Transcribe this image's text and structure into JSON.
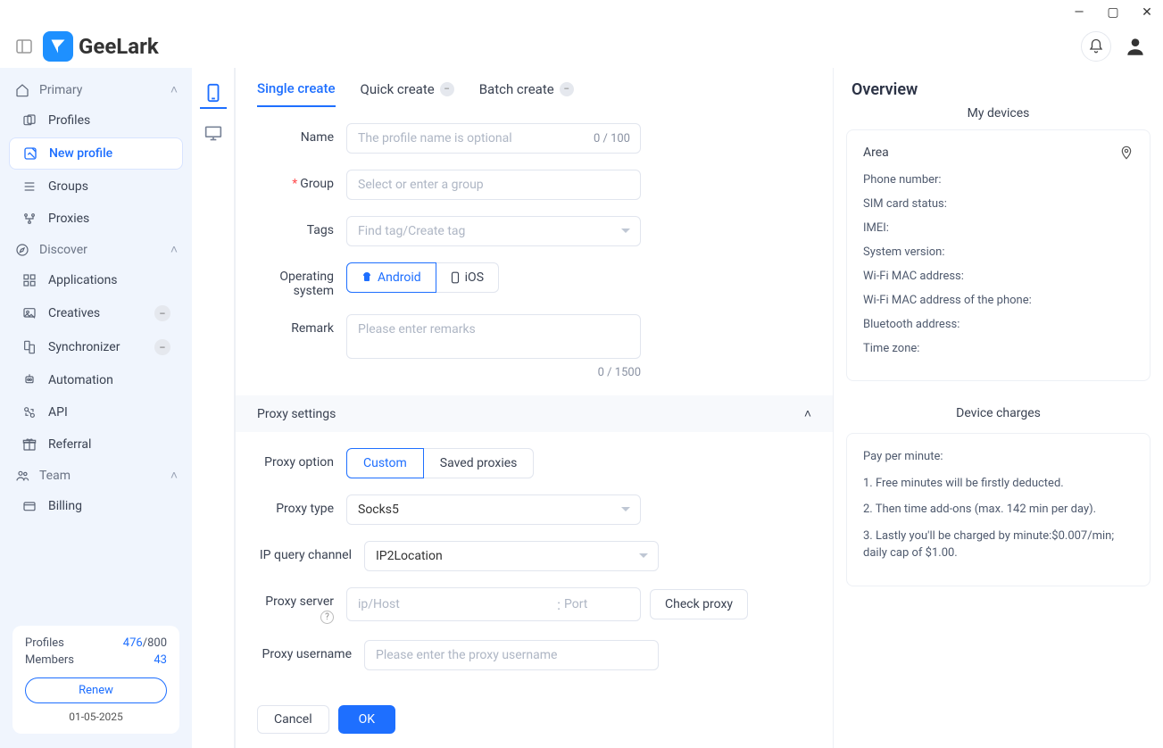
{
  "app": {
    "name": "GeeLark"
  },
  "topbar": {},
  "sidebar": {
    "sections": {
      "primary": {
        "label": "Primary"
      },
      "discover": {
        "label": "Discover"
      },
      "team": {
        "label": "Team"
      }
    },
    "items": {
      "profiles": "Profiles",
      "newProfile": "New profile",
      "groups": "Groups",
      "proxies": "Proxies",
      "applications": "Applications",
      "creatives": "Creatives",
      "synchronizer": "Synchronizer",
      "automation": "Automation",
      "api": "API",
      "referral": "Referral",
      "billing": "Billing"
    },
    "footer": {
      "profilesLabel": "Profiles",
      "profilesUsed": "476",
      "profilesSep": "/",
      "profilesTotal": "800",
      "membersLabel": "Members",
      "membersCount": "43",
      "renew": "Renew",
      "date": "01-05-2025"
    }
  },
  "tabs": {
    "single": "Single create",
    "quick": "Quick create",
    "batch": "Batch create"
  },
  "form": {
    "name": {
      "label": "Name",
      "placeholder": "The profile name is optional",
      "counter": "0 / 100"
    },
    "group": {
      "label": "Group",
      "placeholder": "Select or enter a group"
    },
    "tags": {
      "label": "Tags",
      "placeholder": "Find tag/Create tag"
    },
    "os": {
      "label": "Operating system",
      "android": "Android",
      "ios": "iOS"
    },
    "remark": {
      "label": "Remark",
      "placeholder": "Please enter remarks",
      "counter": "0 / 1500"
    },
    "proxy": {
      "section": "Proxy settings",
      "optionLabel": "Proxy option",
      "custom": "Custom",
      "saved": "Saved proxies",
      "typeLabel": "Proxy type",
      "typeValue": "Socks5",
      "ipChannelLabel": "IP query channel",
      "ipChannelValue": "IP2Location",
      "serverLabel": "Proxy server",
      "serverHost": "ip/Host",
      "serverSep": ":",
      "serverPort": "Port",
      "checkProxy": "Check proxy",
      "usernameLabel": "Proxy username",
      "usernamePlaceholder": "Please enter the proxy username"
    },
    "actions": {
      "cancel": "Cancel",
      "ok": "OK"
    }
  },
  "overview": {
    "title": "Overview",
    "myDevices": "My devices",
    "area": "Area",
    "phone": "Phone number:",
    "sim": "SIM card status:",
    "imei": "IMEI:",
    "systemVersion": "System version:",
    "wifiMac": "Wi-Fi MAC address:",
    "wifiMacPhone": "Wi-Fi MAC address of the phone:",
    "bluetooth": "Bluetooth address:",
    "timezone": "Time zone:",
    "chargesTitle": "Device charges",
    "charges": {
      "payPerMin": "Pay per minute:",
      "l1": "1. Free minutes will be firstly deducted.",
      "l2": "2. Then time add-ons (max. 142 min per day).",
      "l3": "3. Lastly you'll be charged by minute:$0.007/min; daily cap of $1.00."
    }
  }
}
